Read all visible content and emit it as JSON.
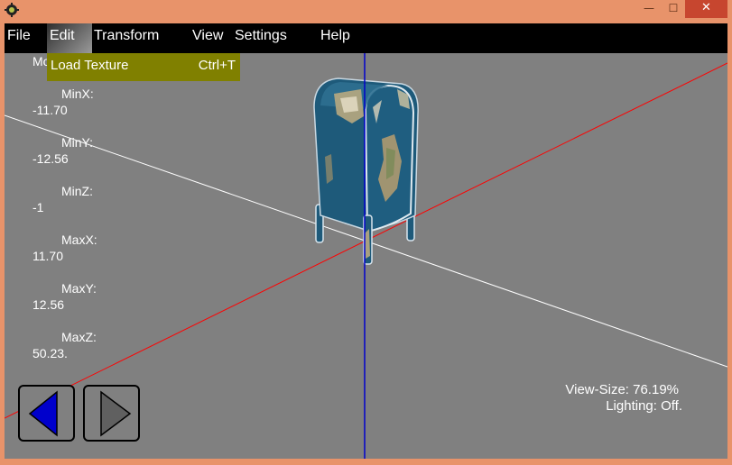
{
  "window": {
    "minimize_glyph": "—",
    "maximize_glyph": "☐",
    "close_glyph": "✕"
  },
  "menubar": {
    "file": "File",
    "edit": "Edit",
    "transform": "Transform",
    "view": "View",
    "settings": "Settings",
    "help": "Help"
  },
  "edit_menu": {
    "load_texture": "Load Texture",
    "load_texture_shortcut": "Ctrl+T"
  },
  "info": {
    "model_label_partial": "Mo",
    "minx_label": "MinX:",
    "minx_value": "-11.70",
    "miny_label": "MinY:",
    "miny_value": "-12.56",
    "minz_label": "MinZ:",
    "minz_value": "-1",
    "maxx_label": "MaxX:",
    "maxx_value": "11.70",
    "maxy_label": "MaxY:",
    "maxy_value": "12.56",
    "maxz_label": "MaxZ:",
    "maxz_value": "50.23."
  },
  "status": {
    "view_size": "View-Size: 76.19%",
    "lighting": "Lighting: Off."
  },
  "colors": {
    "titlebar": "#E8936A",
    "viewport_bg": "#808080",
    "menu_highlight": "#808000",
    "axis_x": "#FF0000",
    "axis_y": "#FFFFFF",
    "axis_z": "#0000CC",
    "mailbox_blue": "#1E5A7A",
    "prev_arrow": "#0000CC",
    "next_arrow": "#606060"
  },
  "icons": {
    "app": "app-icon",
    "prev": "triangle-left-icon",
    "next": "triangle-right-icon"
  }
}
